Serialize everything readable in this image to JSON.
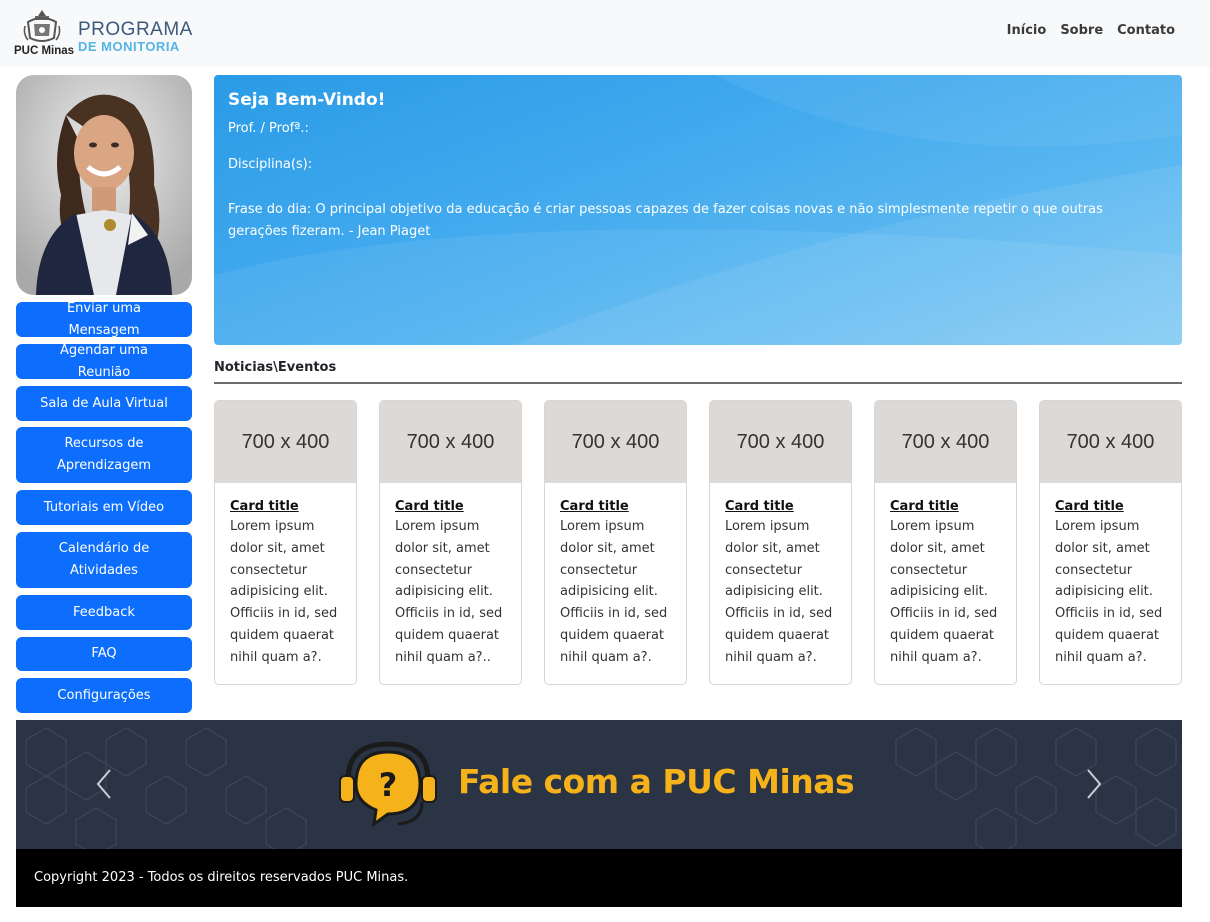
{
  "header": {
    "crest_label": "PUC Minas",
    "program_line1": "PROGRAMA",
    "program_line2": "DE MONITORIA",
    "nav": [
      "Início",
      "Sobre",
      "Contato"
    ]
  },
  "sidebar": {
    "buttons": [
      "Enviar uma Mensagem",
      "Agendar uma Reunião",
      "Sala de Aula Virtual",
      "Recursos de Aprendizagem",
      "Tutoriais em Vídeo",
      "Calendário de Atividades",
      "Feedback",
      "FAQ",
      "Configurações"
    ]
  },
  "welcome": {
    "title": "Seja Bem-Vindo!",
    "prof_label": "Prof. / Profª.:",
    "disciplina_label": "Disciplina(s):",
    "quote": "Frase do dia: O principal objetivo da educação é criar pessoas capazes de fazer coisas novas e não simplesmente repetir o que outras gerações fizeram. - Jean Piaget"
  },
  "news": {
    "heading": "Noticias\\Eventos",
    "cards": [
      {
        "image": "700 x 400",
        "title": "Card title",
        "text": "Lorem ipsum dolor sit, amet consectetur adipisicing elit. Officiis in id, sed quidem quaerat nihil quam a?."
      },
      {
        "image": "700 x 400",
        "title": "Card title",
        "text": "Lorem ipsum dolor sit, amet consectetur adipisicing elit. Officiis in id, sed quidem quaerat nihil quam a?.."
      },
      {
        "image": "700 x 400",
        "title": "Card title",
        "text": "Lorem ipsum dolor sit, amet consectetur adipisicing elit. Officiis in id, sed quidem quaerat nihil quam a?."
      },
      {
        "image": "700 x 400",
        "title": "Card title",
        "text": "Lorem ipsum dolor sit, amet consectetur adipisicing elit. Officiis in id, sed quidem quaerat nihil quam a?."
      },
      {
        "image": "700 x 400",
        "title": "Card title",
        "text": "Lorem ipsum dolor sit, amet consectetur adipisicing elit. Officiis in id, sed quidem quaerat nihil quam a?."
      },
      {
        "image": "700 x 400",
        "title": "Card title",
        "text": "Lorem ipsum dolor sit, amet consectetur adipisicing elit. Officiis in id, sed quidem quaerat nihil quam a?."
      }
    ]
  },
  "carousel": {
    "slide_text": "Fale com a PUC Minas",
    "prev_icon": "chevron-left-icon",
    "next_icon": "chevron-right-icon"
  },
  "footer": {
    "copyright": "Copyright 2023 - Todos os direitos reservados PUC Minas."
  },
  "colors": {
    "primary": "#0d6efd",
    "banner_accent": "#f5b21b",
    "banner_bg": "#2a3444"
  }
}
